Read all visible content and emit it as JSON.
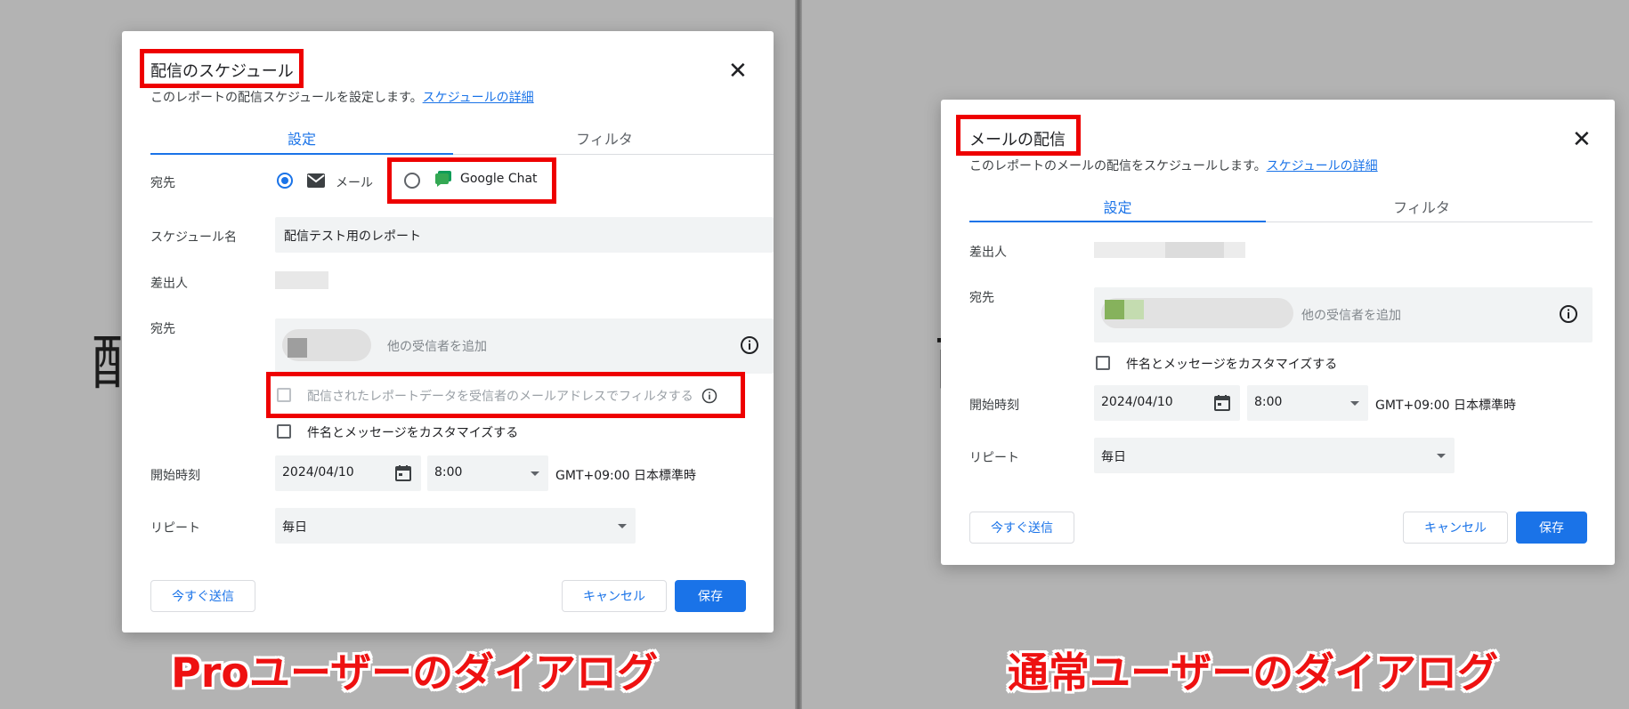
{
  "left": {
    "background_glyph": "配",
    "dialog": {
      "title": "配信のスケジュール",
      "description": "このレポートの配信スケジュールを設定します。",
      "details_link": "スケジュールの詳細",
      "tabs": [
        "設定",
        "フィルタ"
      ],
      "destination_label": "宛先",
      "radio_email": "メール",
      "radio_chat": "Google Chat",
      "schedule_name_label": "スケジュール名",
      "schedule_name_value": "配信テスト用のレポート",
      "sender_label": "差出人",
      "recipients_label": "宛先",
      "recipients_placeholder": "他の受信者を追加",
      "filter_checkbox_label": "配信されたレポートデータを受信者のメールアドレスでフィルタする",
      "customize_checkbox_label": "件名とメッセージをカスタマイズする",
      "start_time_label": "開始時刻",
      "start_date": "2024/04/10",
      "start_time": "8:00",
      "timezone": "GMT+09:00 日本標準時",
      "repeat_label": "リピート",
      "repeat_value": "毎日",
      "send_now": "今すぐ送信",
      "cancel": "キャンセル",
      "save": "保存"
    },
    "caption": "Proユーザーのダイアログ"
  },
  "right": {
    "background_glyph": "酉",
    "dialog": {
      "title": "メールの配信",
      "description": "このレポートのメールの配信をスケジュールします。",
      "details_link": "スケジュールの詳細",
      "tabs": [
        "設定",
        "フィルタ"
      ],
      "sender_label": "差出人",
      "recipients_label": "宛先",
      "recipients_placeholder": "他の受信者を追加",
      "customize_checkbox_label": "件名とメッセージをカスタマイズする",
      "start_time_label": "開始時刻",
      "start_date": "2024/04/10",
      "start_time": "8:00",
      "timezone": "GMT+09:00 日本標準時",
      "repeat_label": "リピート",
      "repeat_value": "毎日",
      "send_now": "今すぐ送信",
      "cancel": "キャンセル",
      "save": "保存"
    },
    "caption": "通常ユーザーのダイアログ"
  },
  "colors": {
    "accent": "#1a73e8",
    "highlight": "#ee0000",
    "chat_green": "#34a853"
  }
}
